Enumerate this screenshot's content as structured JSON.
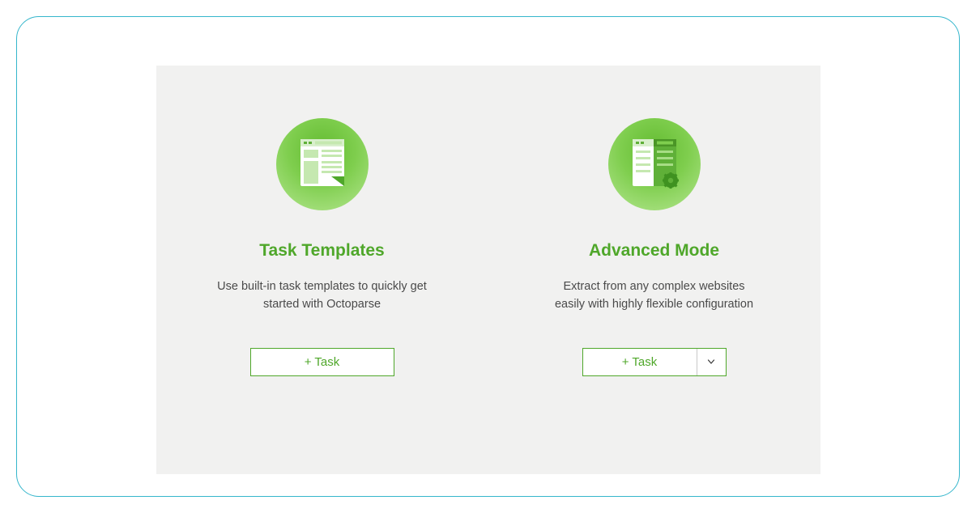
{
  "colors": {
    "accent_green": "#4fa72a",
    "frame_border": "#35b6cc",
    "panel_bg": "#f1f1f0"
  },
  "options": {
    "templates": {
      "title": "Task Templates",
      "description": "Use built-in task templates to quickly get started with Octoparse",
      "button_label": "+ Task",
      "icon": "template-page-icon"
    },
    "advanced": {
      "title": "Advanced Mode",
      "description": "Extract from any complex websites easily with highly flexible configuration",
      "button_label": "+ Task",
      "icon": "advanced-config-icon"
    }
  }
}
